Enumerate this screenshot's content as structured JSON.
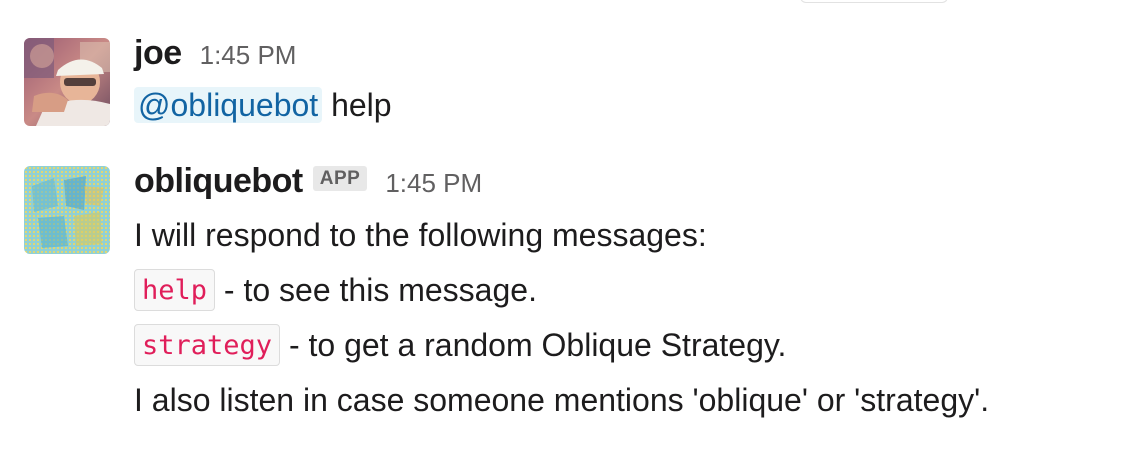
{
  "messages": [
    {
      "author": "joe",
      "time": "1:45 PM",
      "avatar_icon": "user-photo-avatar",
      "mention": "@obliquebot",
      "text": " help"
    },
    {
      "author": "obliquebot",
      "badge": "APP",
      "time": "1:45 PM",
      "avatar_icon": "bot-avatar-pattern",
      "lines": {
        "intro": "I will respond to the following messages:",
        "help_cmd": "help",
        "help_desc": " - to see this message.",
        "strategy_cmd": "strategy",
        "strategy_desc": " - to get a random Oblique Strategy.",
        "outro": "I also listen in case someone mentions 'oblique' or 'strategy'."
      }
    }
  ],
  "colors": {
    "mention_bg": "#e8f5fa",
    "mention_text": "#1264a3",
    "code_text": "#e01e5a",
    "timestamp": "#616061"
  }
}
